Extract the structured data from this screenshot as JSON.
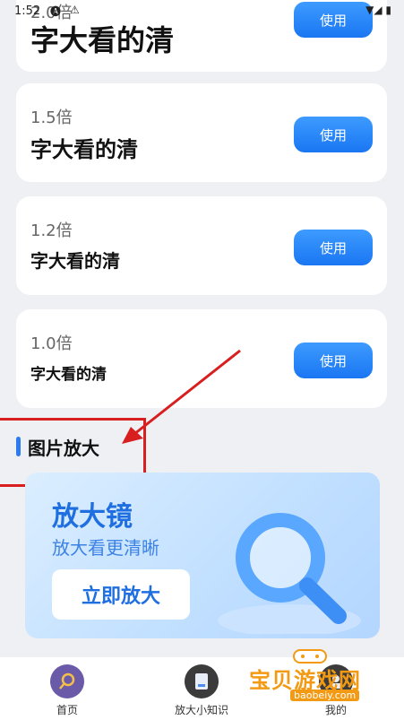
{
  "status_bar": {
    "time": "1:52"
  },
  "cards": [
    {
      "multiplier": "2.0倍",
      "sample": "字大看的清",
      "button": "使用"
    },
    {
      "multiplier": "1.5倍",
      "sample": "字大看的清",
      "button": "使用"
    },
    {
      "multiplier": "1.2倍",
      "sample": "字大看的清",
      "button": "使用"
    },
    {
      "multiplier": "1.0倍",
      "sample": "字大看的清",
      "button": "使用"
    }
  ],
  "section": {
    "title": "图片放大"
  },
  "banner": {
    "title": "放大镜",
    "subtitle": "放大看更清晰",
    "button": "立即放大"
  },
  "nav": {
    "items": [
      {
        "label": "首页",
        "icon": "magnifier-icon"
      },
      {
        "label": "放大小知识",
        "icon": "book-icon"
      },
      {
        "label": "我的",
        "icon": "user-icon"
      }
    ]
  },
  "watermark": {
    "text": "宝贝游戏网",
    "url": "baobeiy.com"
  },
  "colors": {
    "accent": "#1a76f2",
    "annotation": "#d81e1e",
    "watermark": "#f29a14"
  }
}
